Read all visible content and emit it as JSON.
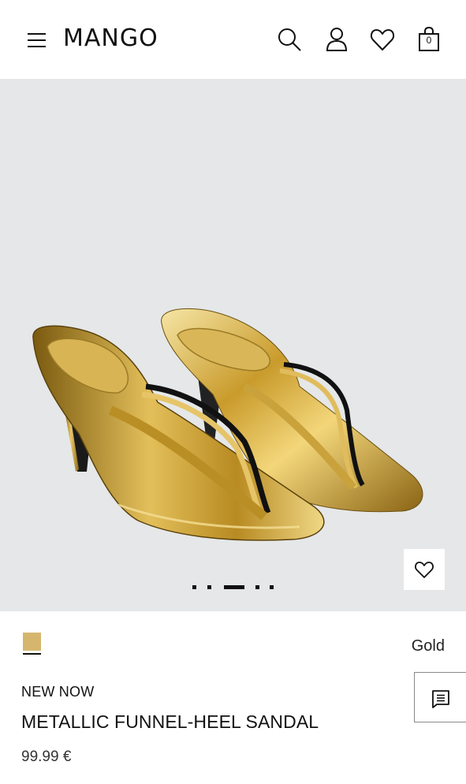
{
  "header": {
    "logo": "MANGO",
    "cart_count": "0",
    "icons": [
      "menu-icon",
      "search-icon",
      "user-icon",
      "heart-icon",
      "bag-icon"
    ]
  },
  "gallery": {
    "image_count": 5,
    "active_index": 2,
    "background": "#e5e7e8"
  },
  "product": {
    "badge": "NEW NOW",
    "name": "METALLIC FUNNEL-HEEL SANDAL",
    "price": "99.99 €",
    "color_name": "Gold",
    "swatch_color": "#d6b66e"
  },
  "colors": {
    "gold": "#c9a23c",
    "gold_dark": "#8a6a1a",
    "gold_light": "#f3df9a"
  }
}
